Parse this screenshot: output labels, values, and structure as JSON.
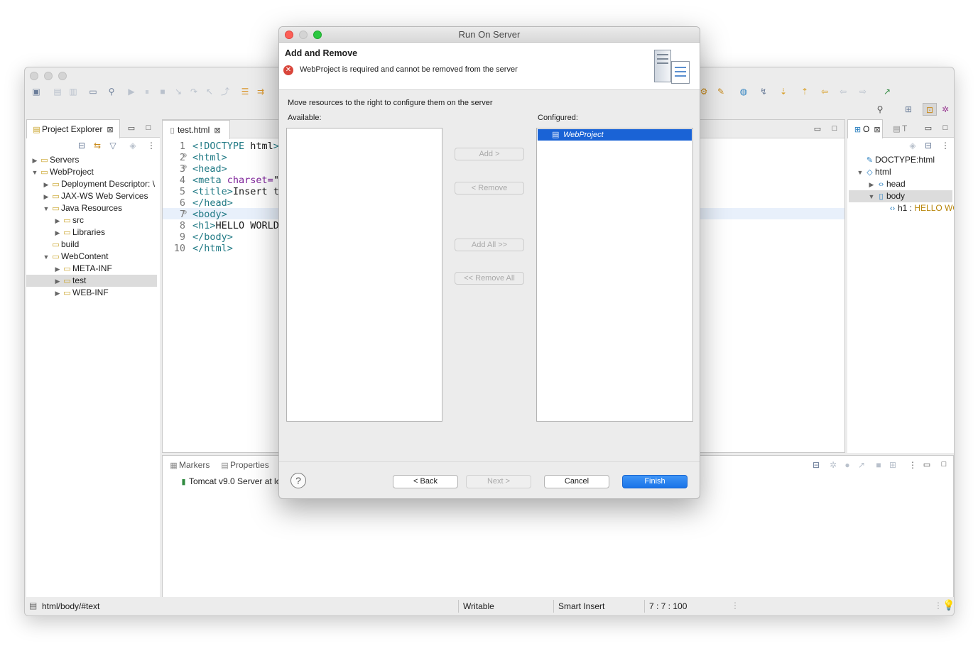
{
  "ide": {
    "project_explorer": {
      "tab_label": "Project Explorer",
      "tree": [
        {
          "label": "Servers",
          "level": 0,
          "expanded": false
        },
        {
          "label": "WebProject",
          "level": 0,
          "expanded": true
        },
        {
          "label": "Deployment Descriptor: \\",
          "level": 1,
          "expanded": false
        },
        {
          "label": "JAX-WS Web Services",
          "level": 1,
          "expanded": false
        },
        {
          "label": "Java Resources",
          "level": 1,
          "expanded": true
        },
        {
          "label": "src",
          "level": 2,
          "expanded": false
        },
        {
          "label": "Libraries",
          "level": 2,
          "expanded": false
        },
        {
          "label": "build",
          "level": 1,
          "expanded": null
        },
        {
          "label": "WebContent",
          "level": 1,
          "expanded": true
        },
        {
          "label": "META-INF",
          "level": 2,
          "expanded": false
        },
        {
          "label": "test",
          "level": 2,
          "expanded": false,
          "selected": true
        },
        {
          "label": "WEB-INF",
          "level": 2,
          "expanded": false
        }
      ]
    },
    "editor": {
      "tab_label": "test.html",
      "lines": [
        {
          "n": "1",
          "fold": "",
          "text": "<!DOCTYPE html>"
        },
        {
          "n": "2",
          "fold": "⊖",
          "text": "<html>"
        },
        {
          "n": "3",
          "fold": "⊖",
          "text": "<head>"
        },
        {
          "n": "4",
          "fold": "",
          "text": "<meta charset=\""
        },
        {
          "n": "5",
          "fold": "",
          "text": "<title>Insert t"
        },
        {
          "n": "6",
          "fold": "",
          "text": "</head>"
        },
        {
          "n": "7",
          "fold": "⊖",
          "text": "<body>"
        },
        {
          "n": "8",
          "fold": "",
          "text": "<h1>HELLO WORLD"
        },
        {
          "n": "9",
          "fold": "",
          "text": "</body>"
        },
        {
          "n": "10",
          "fold": "",
          "text": "</html>"
        }
      ]
    },
    "outline": {
      "tab_o": "O",
      "tab_t": "T",
      "tree": [
        {
          "label": "DOCTYPE:html",
          "level": 0
        },
        {
          "label": "html",
          "level": 0
        },
        {
          "label": "head",
          "level": 1
        },
        {
          "label": "body",
          "level": 1
        },
        {
          "label": "h1 : ",
          "value": "HELLO WO",
          "level": 2
        }
      ]
    },
    "bottom": {
      "tab_markers": "Markers",
      "tab_properties": "Properties",
      "server_row": "Tomcat v9.0 Server at lo"
    },
    "status_bar": {
      "path": "html/body/#text",
      "writable": "Writable",
      "insert_mode": "Smart Insert",
      "position": "7 : 7 : 100"
    }
  },
  "dialog": {
    "title": "Run On Server",
    "header_title": "Add and Remove",
    "error_message": "WebProject is required and cannot be removed from the server",
    "instruction": "Move resources to the right to configure them on the server",
    "available_label": "Available:",
    "configured_label": "Configured:",
    "available_items": [],
    "configured_items": [
      "WebProject"
    ],
    "buttons": {
      "add": "Add >",
      "remove": "< Remove",
      "add_all": "Add All >>",
      "remove_all": "<< Remove All",
      "back": "< Back",
      "next": "Next >",
      "cancel": "Cancel",
      "finish": "Finish"
    },
    "help_symbol": "?",
    "colors": {
      "selection": "#1a63d6",
      "error": "#d9463b",
      "primary_button": "#1a74e8"
    }
  }
}
